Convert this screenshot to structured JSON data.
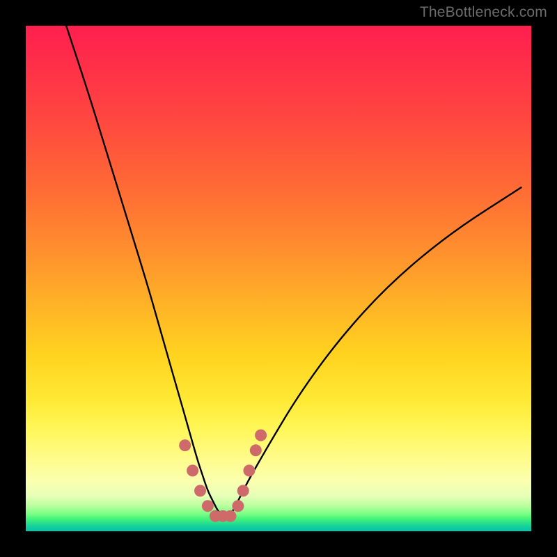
{
  "watermark": "TheBottleneck.com",
  "colors": {
    "background": "#000000",
    "curve": "#000000",
    "marker": "#cf6a6a"
  },
  "chart_data": {
    "type": "line",
    "title": "",
    "xlabel": "",
    "ylabel": "",
    "xlim": [
      0,
      100
    ],
    "ylim": [
      0,
      100
    ],
    "grid": false,
    "legend": false,
    "series": [
      {
        "name": "bottleneck-curve",
        "x": [
          8,
          12,
          16,
          20,
          24,
          26,
          28,
          30,
          32,
          34,
          35,
          36,
          37,
          38,
          39,
          40,
          41,
          42,
          44,
          48,
          54,
          62,
          72,
          84,
          98
        ],
        "values": [
          100,
          88,
          75,
          62,
          49,
          42,
          35,
          28,
          21,
          14,
          11,
          8,
          6,
          4,
          3,
          3,
          4,
          6,
          10,
          17,
          27,
          38,
          49,
          59,
          68
        ]
      }
    ],
    "markers": {
      "name": "highlight-points",
      "x": [
        31.5,
        33.0,
        34.5,
        36.0,
        37.5,
        39.0,
        40.5,
        42.0,
        43.0,
        44.2,
        45.5,
        46.5
      ],
      "values": [
        17,
        12,
        8,
        5,
        3,
        3,
        3,
        5,
        8,
        12,
        16,
        19
      ]
    }
  }
}
